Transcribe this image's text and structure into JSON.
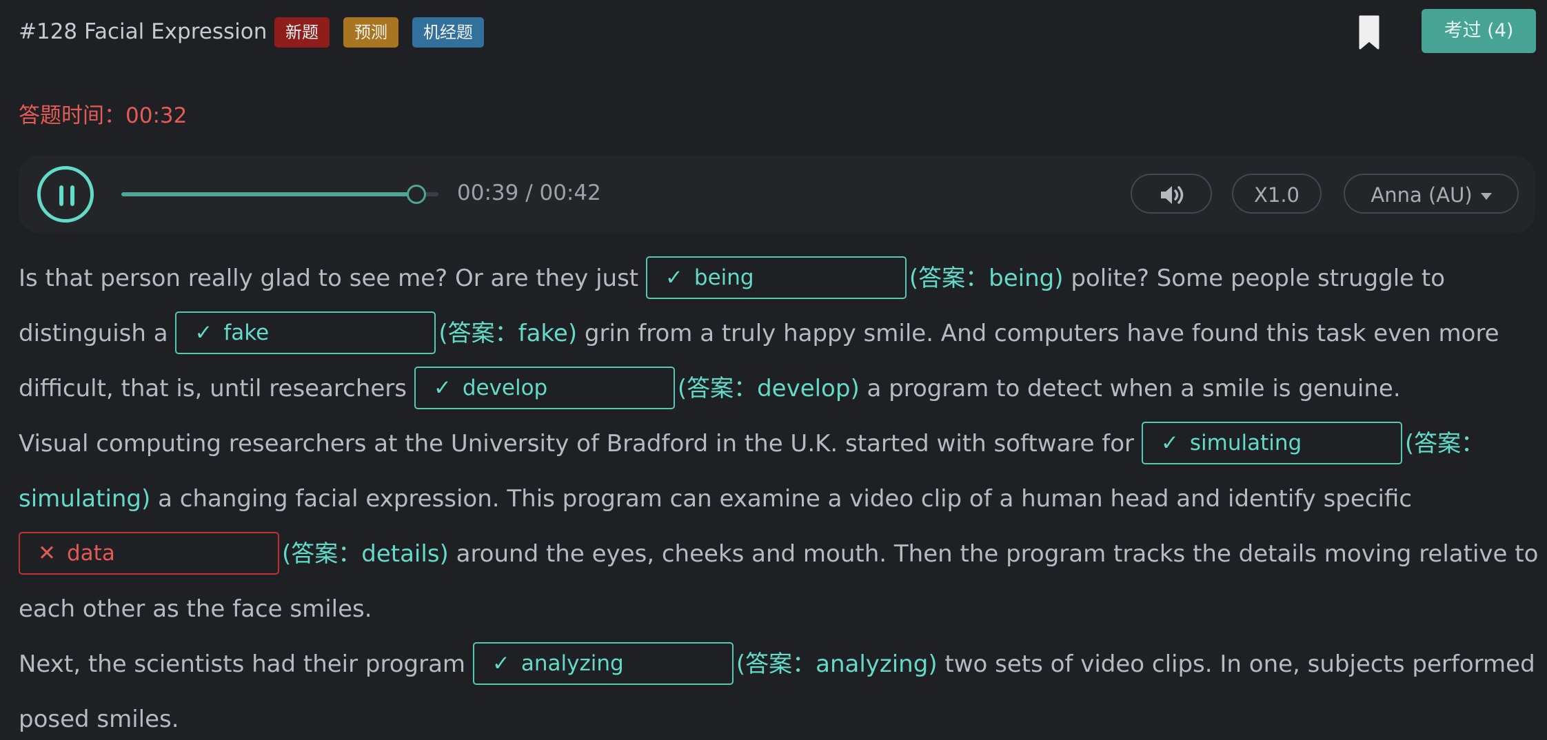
{
  "header": {
    "title": "#128 Facial Expression",
    "tags": [
      "新题",
      "预测",
      "机经题"
    ],
    "passed_button": "考过 (4)"
  },
  "timer": {
    "label": "答题时间：00:32"
  },
  "player": {
    "progress": 0.93,
    "time_readout": "00:39 / 00:42",
    "speed": "X1.0",
    "voice": "Anna (AU)"
  },
  "colors": {
    "accent": "#62dbc9",
    "error": "#e35a55",
    "tag_new": "#8e1d1c",
    "tag_predict": "#a87520",
    "tag_machine": "#31719c",
    "button": "#47a394"
  },
  "icons": [
    "bookmark-icon",
    "pause-icon",
    "volume-icon",
    "caret-down-icon",
    "check-icon",
    "cross-icon"
  ],
  "passage": {
    "l1_before": "Is that person really glad to see me? Or are they just ",
    "b1_value": "being",
    "b1_answer": "(答案：being)",
    "l1_after": " polite? Some people struggle to",
    "l2_before": "distinguish a ",
    "b2_value": "fake",
    "b2_answer": "(答案：fake)",
    "l2_after": " grin from a truly happy smile. And computers have found this task even more",
    "l3_before": "difficult, that is, until researchers ",
    "b3_value": "develop",
    "b3_answer": "(答案：develop)",
    "l3_after": " a program to detect when a smile is genuine.",
    "l4_before": "Visual computing researchers at the University of Bradford in the U.K. started with software for ",
    "b4_value": "simulating",
    "b4_answer_part1": "(答案：",
    "l5_answer_part2": "simulating)",
    "l5_after": " a changing facial expression. This program can examine a video clip of a human head and identify specific",
    "b5_value": "data",
    "b5_answer": "(答案：details)",
    "l6_after": " around the eyes, cheeks and mouth. Then the program tracks the details moving relative to",
    "l7": "each other as the face smiles.",
    "l8_before": "Next, the scientists had their program ",
    "b6_value": "analyzing",
    "b6_answer": "(答案：analyzing)",
    "l8_after": " two sets of video clips. In one, subjects performed",
    "l9": "posed smiles."
  }
}
